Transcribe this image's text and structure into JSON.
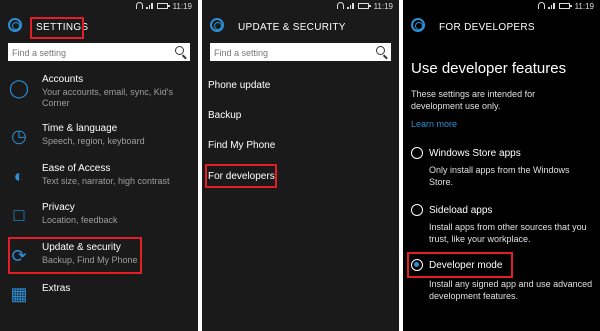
{
  "status": {
    "time": "11:19"
  },
  "panel1": {
    "title": "SETTINGS",
    "search_placeholder": "Find a setting",
    "items": [
      {
        "label": "Accounts",
        "sub": "Your accounts, email, sync, Kid's Corner",
        "icon": "person-icon"
      },
      {
        "label": "Time & language",
        "sub": "Speech, region, keyboard",
        "icon": "time-language-icon"
      },
      {
        "label": "Ease of Access",
        "sub": "Text size, narrator, high contrast",
        "icon": "ease-of-access-icon"
      },
      {
        "label": "Privacy",
        "sub": "Location, feedback",
        "icon": "lock-icon"
      },
      {
        "label": "Update & security",
        "sub": "Backup, Find My Phone",
        "icon": "refresh-icon"
      },
      {
        "label": "Extras",
        "sub": "",
        "icon": "extras-grid-icon"
      }
    ]
  },
  "panel2": {
    "title": "UPDATE & SECURITY",
    "search_placeholder": "Find a setting",
    "items": [
      "Phone update",
      "Backup",
      "Find My Phone",
      "For developers"
    ]
  },
  "panel3": {
    "title": "FOR DEVELOPERS",
    "heading": "Use developer features",
    "description": "These settings are intended for development use only.",
    "learn_more": "Learn more",
    "options": [
      {
        "label": "Windows Store apps",
        "desc": "Only install apps from the Windows Store.",
        "selected": false
      },
      {
        "label": "Sideload apps",
        "desc": "Install apps from other sources that you trust, like your workplace.",
        "selected": false
      },
      {
        "label": "Developer mode",
        "desc": "Install any signed app and use advanced development features.",
        "selected": true
      }
    ]
  },
  "colors": {
    "accent": "#2b8fd6",
    "highlight": "#e41e26",
    "background": "#1a1a1a"
  }
}
